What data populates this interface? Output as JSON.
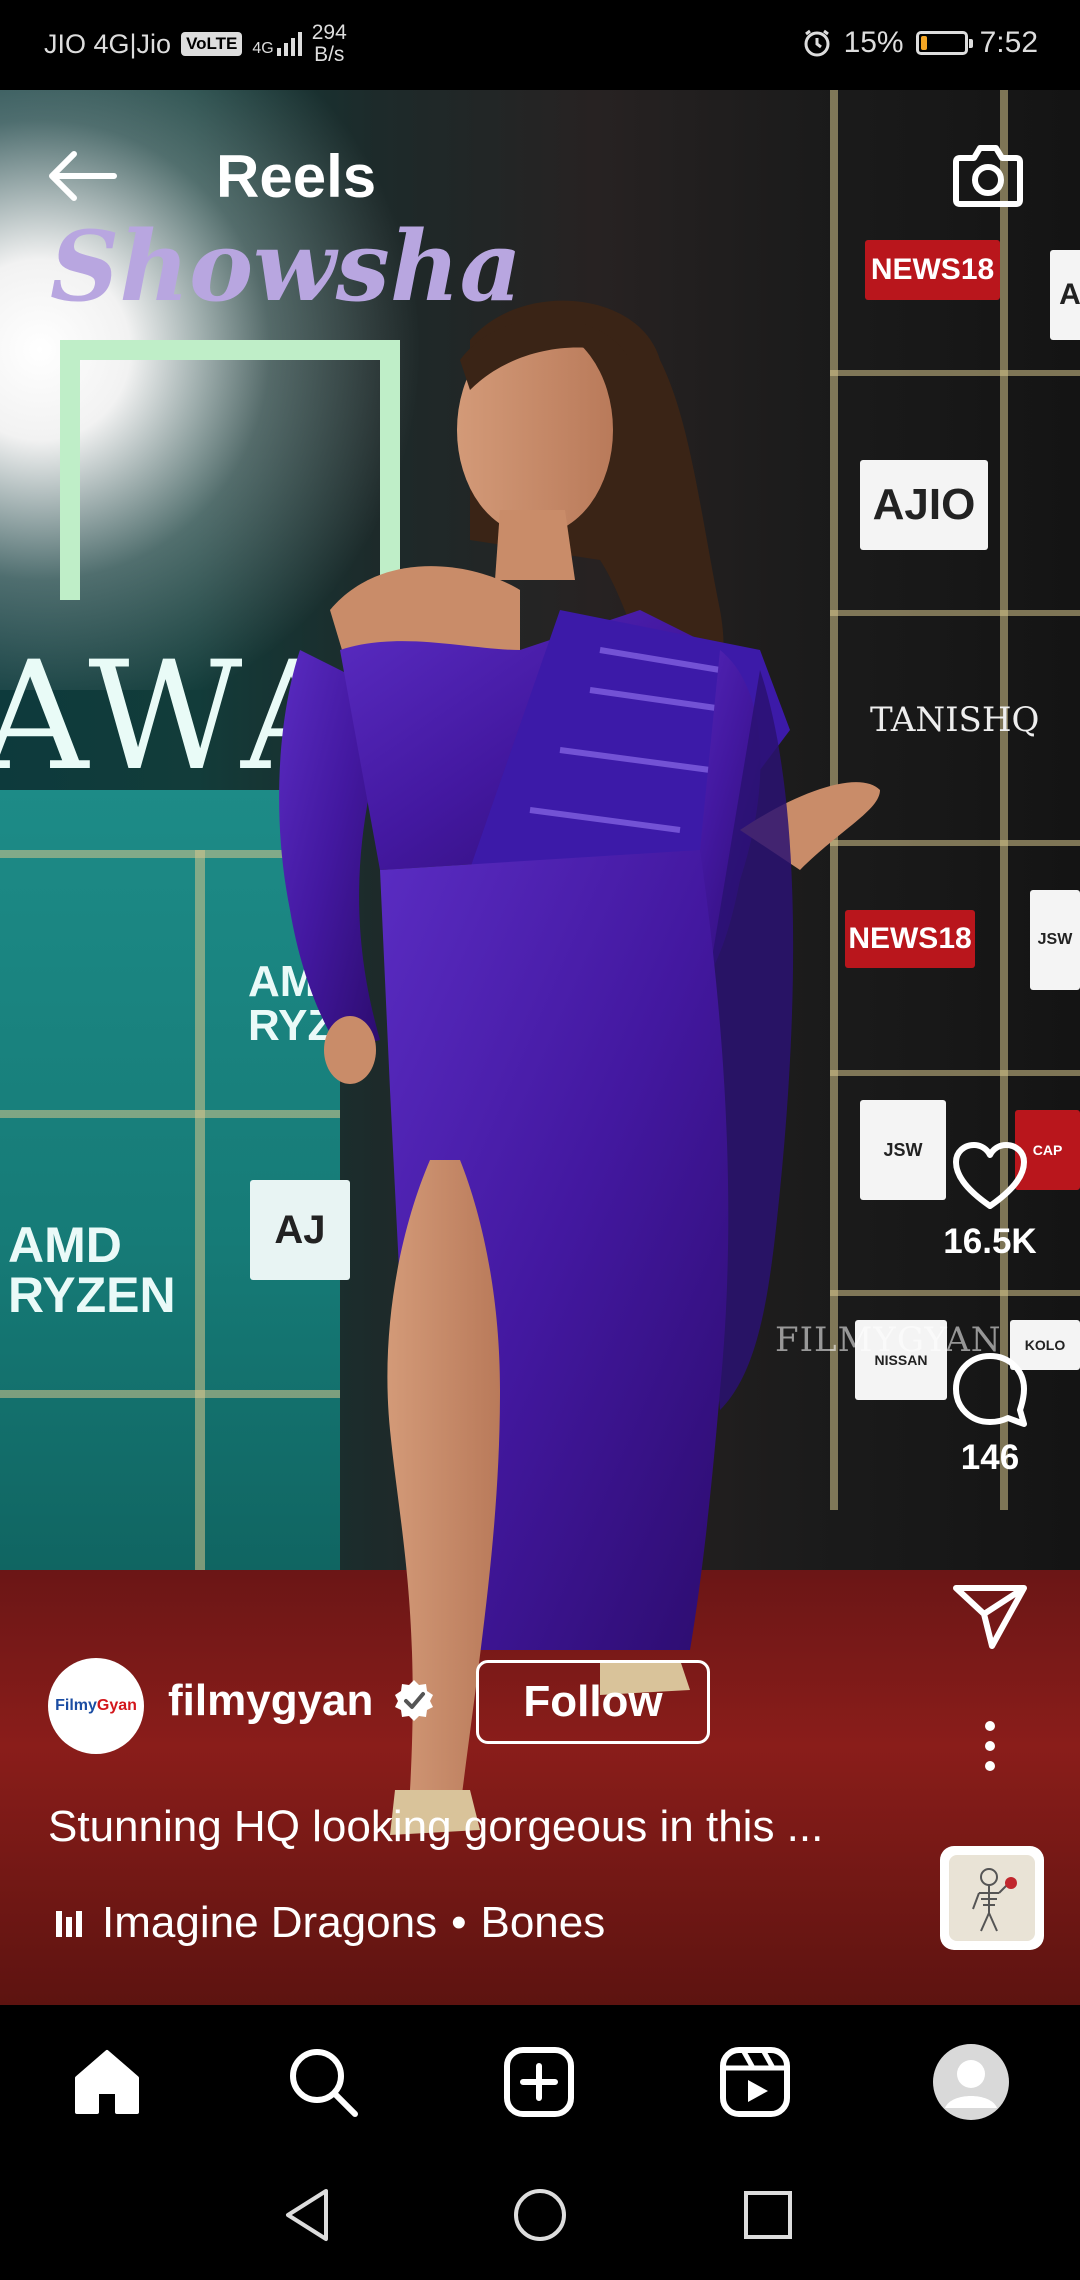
{
  "status_bar": {
    "carrier": "JIO 4G|Jio",
    "volte": "VoLTE",
    "signal": "4G",
    "net_speed_value": "294",
    "net_speed_unit": "B/s",
    "battery_percent": "15%",
    "battery_level": 0.15,
    "time": "7:52"
  },
  "header": {
    "title": "Reels"
  },
  "reel": {
    "likes": "16.5K",
    "comments": "146",
    "account": {
      "avatar_text_1": "Filmy",
      "avatar_text_2": "Gyan",
      "username": "filmygyan",
      "follow_label": "Follow"
    },
    "caption": "Stunning HQ looking gorgeous in this ...",
    "music": {
      "artist": "Imagine Dragons",
      "separator": "•",
      "song": "Bones"
    },
    "watermark": "FILMYGYAN"
  },
  "bottom_nav": {
    "items": [
      "home-icon",
      "search-icon",
      "create-icon",
      "reels-icon",
      "profile-icon"
    ]
  },
  "colors": {
    "background": "#000000",
    "battery_low": "#f5a623",
    "dress": "#4b1fa6"
  }
}
